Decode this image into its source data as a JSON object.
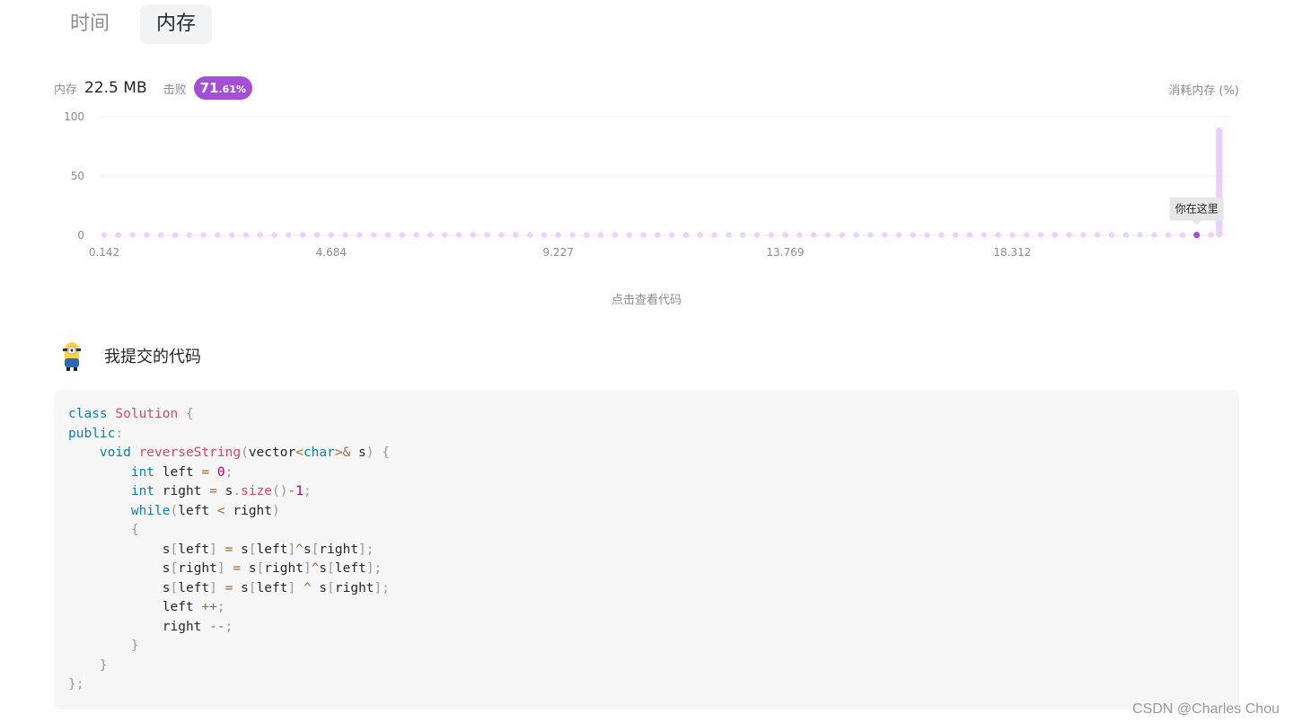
{
  "tabs": {
    "time": "时间",
    "memory": "内存"
  },
  "stats": {
    "memory_label": "内存",
    "memory_value": "22.5 MB",
    "beat_label": "击败",
    "beat_int": "71",
    "beat_dec": ".61%"
  },
  "chart_data": {
    "type": "line",
    "ylabel": "消耗内存 (%)",
    "y_ticks": [
      "100",
      "50",
      "0"
    ],
    "x_tick_labels": [
      "0.142",
      "4.684",
      "9.227",
      "13.769",
      "18.312"
    ],
    "ylim": [
      0,
      100
    ],
    "xlim": [
      0.142,
      22.49
    ],
    "series": [
      {
        "x": [
          0.142,
          0.425,
          0.709,
          0.993,
          1.277,
          1.561,
          1.845,
          2.129,
          2.413,
          2.697,
          2.981,
          3.265,
          3.549,
          3.833,
          4.117,
          4.4,
          4.684,
          4.968,
          5.252,
          5.536,
          5.82,
          6.104,
          6.388,
          6.672,
          6.955,
          7.239,
          7.523,
          7.807,
          8.091,
          8.375,
          8.659,
          8.943,
          9.227,
          9.511,
          9.795,
          10.079,
          10.363,
          10.647,
          10.931,
          11.215,
          11.499,
          11.782,
          12.066,
          12.35,
          12.634,
          12.918,
          13.202,
          13.486,
          13.769,
          14.053,
          14.337,
          14.621,
          14.905,
          15.189,
          15.473,
          15.757,
          16.041,
          16.325,
          16.609,
          16.892,
          17.176,
          17.46,
          17.744,
          18.028,
          18.312,
          18.596,
          18.88,
          19.164,
          19.448,
          19.732,
          20.016,
          20.3,
          20.584,
          20.868,
          21.152,
          21.436,
          21.72,
          22.004,
          22.288
        ],
        "values": [
          0.3,
          0.3,
          0.3,
          0.3,
          0.3,
          0.3,
          0.3,
          0.3,
          0.3,
          0.3,
          0.3,
          0.3,
          0.3,
          0.3,
          0.3,
          0.3,
          0.3,
          0.3,
          0.3,
          0.3,
          0.3,
          0.3,
          0.3,
          0.3,
          0.3,
          0.3,
          0.3,
          0.3,
          0.3,
          0.3,
          0.3,
          0.3,
          0.3,
          0.3,
          0.3,
          0.3,
          0.3,
          0.3,
          0.3,
          0.3,
          0.3,
          0.3,
          0.3,
          0.3,
          0.3,
          0.3,
          0.3,
          0.3,
          0.3,
          0.3,
          0.3,
          0.3,
          0.3,
          0.3,
          0.3,
          0.3,
          0.3,
          0.3,
          0.3,
          0.3,
          0.3,
          0.3,
          0.3,
          0.3,
          0.3,
          0.3,
          0.3,
          0.3,
          0.3,
          0.3,
          0.3,
          0.3,
          0.3,
          0.3,
          0.3,
          0.3,
          0.3,
          0.3,
          0.3
        ]
      },
      {
        "x": [
          22.45
        ],
        "values": [
          91
        ]
      }
    ],
    "highlight": {
      "x": 22.0,
      "value": 0.3,
      "tooltip": "你在这里"
    },
    "grid": true
  },
  "view_code_link": "点击查看代码",
  "submission": {
    "title": "我提交的代码"
  },
  "code": {
    "lines": [
      [
        [
          "kw",
          "class"
        ],
        [
          "t",
          " "
        ],
        [
          "fn",
          "Solution"
        ],
        [
          "t",
          " "
        ],
        [
          "pn",
          "{"
        ]
      ],
      [
        [
          "kw",
          "public"
        ],
        [
          "pn",
          ":"
        ]
      ],
      [
        [
          "t",
          "    "
        ],
        [
          "kw",
          "void"
        ],
        [
          "t",
          " "
        ],
        [
          "fn",
          "reverseString"
        ],
        [
          "pn",
          "("
        ],
        [
          "t",
          "vector"
        ],
        [
          "op",
          "<"
        ],
        [
          "kw",
          "char"
        ],
        [
          "op",
          ">&"
        ],
        [
          "t",
          " s"
        ],
        [
          "pn",
          ")"
        ],
        [
          "t",
          " "
        ],
        [
          "pn",
          "{"
        ]
      ],
      [
        [
          "t",
          "        "
        ],
        [
          "kw",
          "int"
        ],
        [
          "t",
          " left "
        ],
        [
          "op",
          "="
        ],
        [
          "t",
          " "
        ],
        [
          "num",
          "0"
        ],
        [
          "pn",
          ";"
        ]
      ],
      [
        [
          "t",
          "        "
        ],
        [
          "kw",
          "int"
        ],
        [
          "t",
          " right "
        ],
        [
          "op",
          "="
        ],
        [
          "t",
          " s"
        ],
        [
          "pn",
          "."
        ],
        [
          "fn",
          "size"
        ],
        [
          "pn",
          "()"
        ],
        [
          "op",
          "-"
        ],
        [
          "num",
          "1"
        ],
        [
          "pn",
          ";"
        ]
      ],
      [
        [
          "t",
          "        "
        ],
        [
          "kw",
          "while"
        ],
        [
          "pn",
          "("
        ],
        [
          "t",
          "left "
        ],
        [
          "op",
          "<"
        ],
        [
          "t",
          " right"
        ],
        [
          "pn",
          ")"
        ]
      ],
      [
        [
          "t",
          "        "
        ],
        [
          "pn",
          "{"
        ]
      ],
      [
        [
          "t",
          "            s"
        ],
        [
          "pn",
          "["
        ],
        [
          "t",
          "left"
        ],
        [
          "pn",
          "]"
        ],
        [
          "t",
          " "
        ],
        [
          "op",
          "="
        ],
        [
          "t",
          " s"
        ],
        [
          "pn",
          "["
        ],
        [
          "t",
          "left"
        ],
        [
          "pn",
          "]"
        ],
        [
          "op",
          "^"
        ],
        [
          "t",
          "s"
        ],
        [
          "pn",
          "["
        ],
        [
          "t",
          "right"
        ],
        [
          "pn",
          "];"
        ]
      ],
      [
        [
          "t",
          "            s"
        ],
        [
          "pn",
          "["
        ],
        [
          "t",
          "right"
        ],
        [
          "pn",
          "]"
        ],
        [
          "t",
          " "
        ],
        [
          "op",
          "="
        ],
        [
          "t",
          " s"
        ],
        [
          "pn",
          "["
        ],
        [
          "t",
          "right"
        ],
        [
          "pn",
          "]"
        ],
        [
          "op",
          "^"
        ],
        [
          "t",
          "s"
        ],
        [
          "pn",
          "["
        ],
        [
          "t",
          "left"
        ],
        [
          "pn",
          "];"
        ]
      ],
      [
        [
          "t",
          "            s"
        ],
        [
          "pn",
          "["
        ],
        [
          "t",
          "left"
        ],
        [
          "pn",
          "]"
        ],
        [
          "t",
          " "
        ],
        [
          "op",
          "="
        ],
        [
          "t",
          " s"
        ],
        [
          "pn",
          "["
        ],
        [
          "t",
          "left"
        ],
        [
          "pn",
          "]"
        ],
        [
          "t",
          " "
        ],
        [
          "op",
          "^"
        ],
        [
          "t",
          " s"
        ],
        [
          "pn",
          "["
        ],
        [
          "t",
          "right"
        ],
        [
          "pn",
          "];"
        ]
      ],
      [
        [
          "t",
          "            left "
        ],
        [
          "op",
          "++"
        ],
        [
          "pn",
          ";"
        ]
      ],
      [
        [
          "t",
          "            right "
        ],
        [
          "op",
          "--"
        ],
        [
          "pn",
          ";"
        ]
      ],
      [
        [
          "t",
          "        "
        ],
        [
          "pn",
          "}"
        ]
      ],
      [
        [
          "t",
          "    "
        ],
        [
          "pn",
          "}"
        ]
      ],
      [
        [
          "pn",
          "};"
        ]
      ]
    ]
  },
  "watermark": "CSDN @Charles Chou",
  "colors": {
    "accent": "#a54ed8",
    "dot": "#ecd2fa",
    "bar": "#e8d0f8",
    "highlight": "#a54ed8"
  }
}
